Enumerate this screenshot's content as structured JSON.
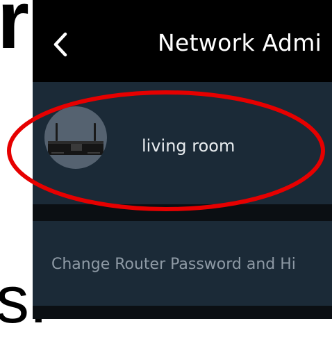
{
  "background_text": {
    "top_letter": "r",
    "bottom_letter": "s."
  },
  "header": {
    "title": "Network Admi",
    "back_icon": "chevron-left-icon"
  },
  "node": {
    "name": "living room",
    "image_icon": "router-icon"
  },
  "settings": {
    "change_password_label": "Change Router Password and Hi"
  },
  "colors": {
    "header_bg": "#000000",
    "card_bg": "#1b2a37",
    "annotation": "#e60000"
  }
}
